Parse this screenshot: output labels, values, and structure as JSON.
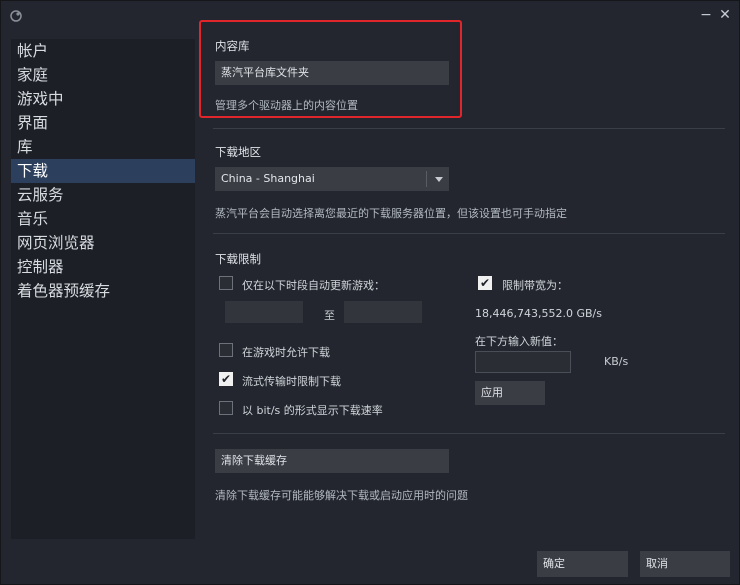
{
  "titlebar": {
    "minimize_glyph": "−",
    "close_glyph": "✕"
  },
  "sidebar": {
    "items": [
      {
        "label": "帐户"
      },
      {
        "label": "家庭"
      },
      {
        "label": "游戏中"
      },
      {
        "label": "界面"
      },
      {
        "label": "库"
      },
      {
        "label": "下载",
        "active": true
      },
      {
        "label": "云服务"
      },
      {
        "label": "音乐"
      },
      {
        "label": "网页浏览器"
      },
      {
        "label": "控制器"
      },
      {
        "label": "着色器预缓存"
      }
    ]
  },
  "content_library": {
    "title": "内容库",
    "button_label": "蒸汽平台库文件夹",
    "description": "管理多个驱动器上的内容位置"
  },
  "download_region": {
    "title": "下载地区",
    "selected": "China - Shanghai",
    "description": "蒸汽平台会自动选择离您最近的下载服务器位置，但该设置也可手动指定"
  },
  "download_limits": {
    "title": "下载限制",
    "only_update_between": {
      "label": "仅在以下时段自动更新游戏：",
      "checked": false
    },
    "to_label": "至",
    "allow_while_playing": {
      "label": "在游戏时允许下载",
      "checked": false
    },
    "throttle_streaming": {
      "label": "流式传输时限制下载",
      "checked": true
    },
    "show_bits": {
      "label": "以 bit/s 的形式显示下载速率",
      "checked": false
    },
    "limit_bandwidth": {
      "label": "限制带宽为：",
      "checked": true
    },
    "bandwidth_value": "18,446,743,552.0 GB/s",
    "new_value_label": "在下方输入新值：",
    "unit": "KB/s",
    "apply_label": "应用"
  },
  "cache": {
    "button_label": "清除下载缓存",
    "description": "清除下载缓存可能能够解决下载或启动应用时的问题"
  },
  "footer": {
    "ok_label": "确定",
    "cancel_label": "取消"
  },
  "colors": {
    "highlight": "#e0262b",
    "active_item": "#2c3f5c"
  },
  "icons": {
    "app": "steam-icon",
    "dropdown": "chevron-down-icon",
    "check": "checkmark-icon"
  }
}
